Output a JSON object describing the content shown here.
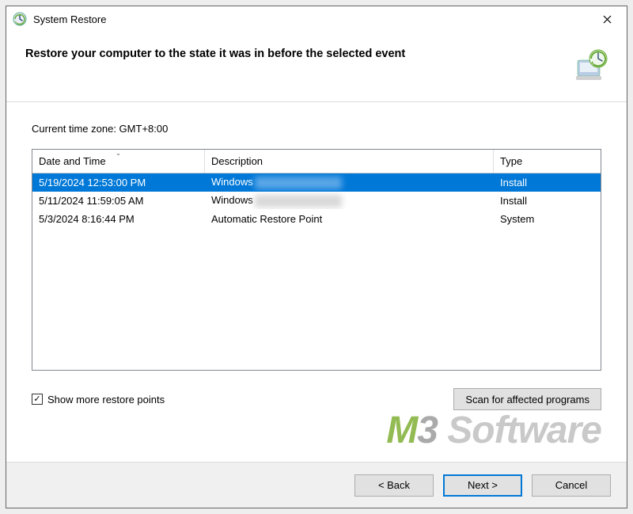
{
  "title_bar": {
    "title": "System Restore"
  },
  "header": {
    "heading": "Restore your computer to the state it was in before the selected event"
  },
  "timezone": {
    "label": "Current time zone: GMT+8:00"
  },
  "table": {
    "columns": {
      "date": "Date and Time",
      "description": "Description",
      "type": "Type"
    },
    "rows": [
      {
        "date": "5/19/2024 12:53:00 PM",
        "description": "Windows",
        "type": "Install",
        "selected": true,
        "blurred": true
      },
      {
        "date": "5/11/2024 11:59:05 AM",
        "description": "Windows",
        "type": "Install",
        "selected": false,
        "blurred": true
      },
      {
        "date": "5/3/2024 8:16:44 PM",
        "description": "Automatic Restore Point",
        "type": "System",
        "selected": false,
        "blurred": false
      }
    ]
  },
  "below": {
    "checkbox_label": "Show more restore points",
    "checkbox_checked": true,
    "scan_button": "Scan for affected programs"
  },
  "footer": {
    "back": "< Back",
    "next": "Next >",
    "cancel": "Cancel"
  },
  "watermark": {
    "m": "M",
    "three": "3",
    "soft": " Software"
  }
}
